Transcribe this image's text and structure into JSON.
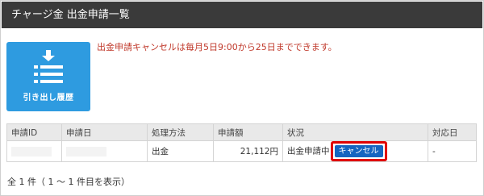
{
  "header": {
    "title": "チャージ金 出金申請一覧"
  },
  "history_button": {
    "label": "引き出し履歴",
    "icon": "list-download-icon"
  },
  "notice": "出金申請キャンセルは毎月5日9:00から25日までできます。",
  "table": {
    "columns": [
      "申請ID",
      "申請日",
      "処理方法",
      "申請額",
      "状況",
      "対応日"
    ],
    "rows": [
      {
        "id": "",
        "date": "",
        "method": "出金",
        "amount": "21,112円",
        "status": "出金申請中",
        "cancel_label": "キャンセル",
        "response_date": "-"
      }
    ]
  },
  "summary": "全 1 件（ 1 ～ 1 件目を表示）",
  "colors": {
    "header_bg": "#3a3a3a",
    "tile_bg": "#2e9be0",
    "notice": "#c0392b",
    "cancel_bg": "#1565c0",
    "highlight": "#e00000"
  }
}
